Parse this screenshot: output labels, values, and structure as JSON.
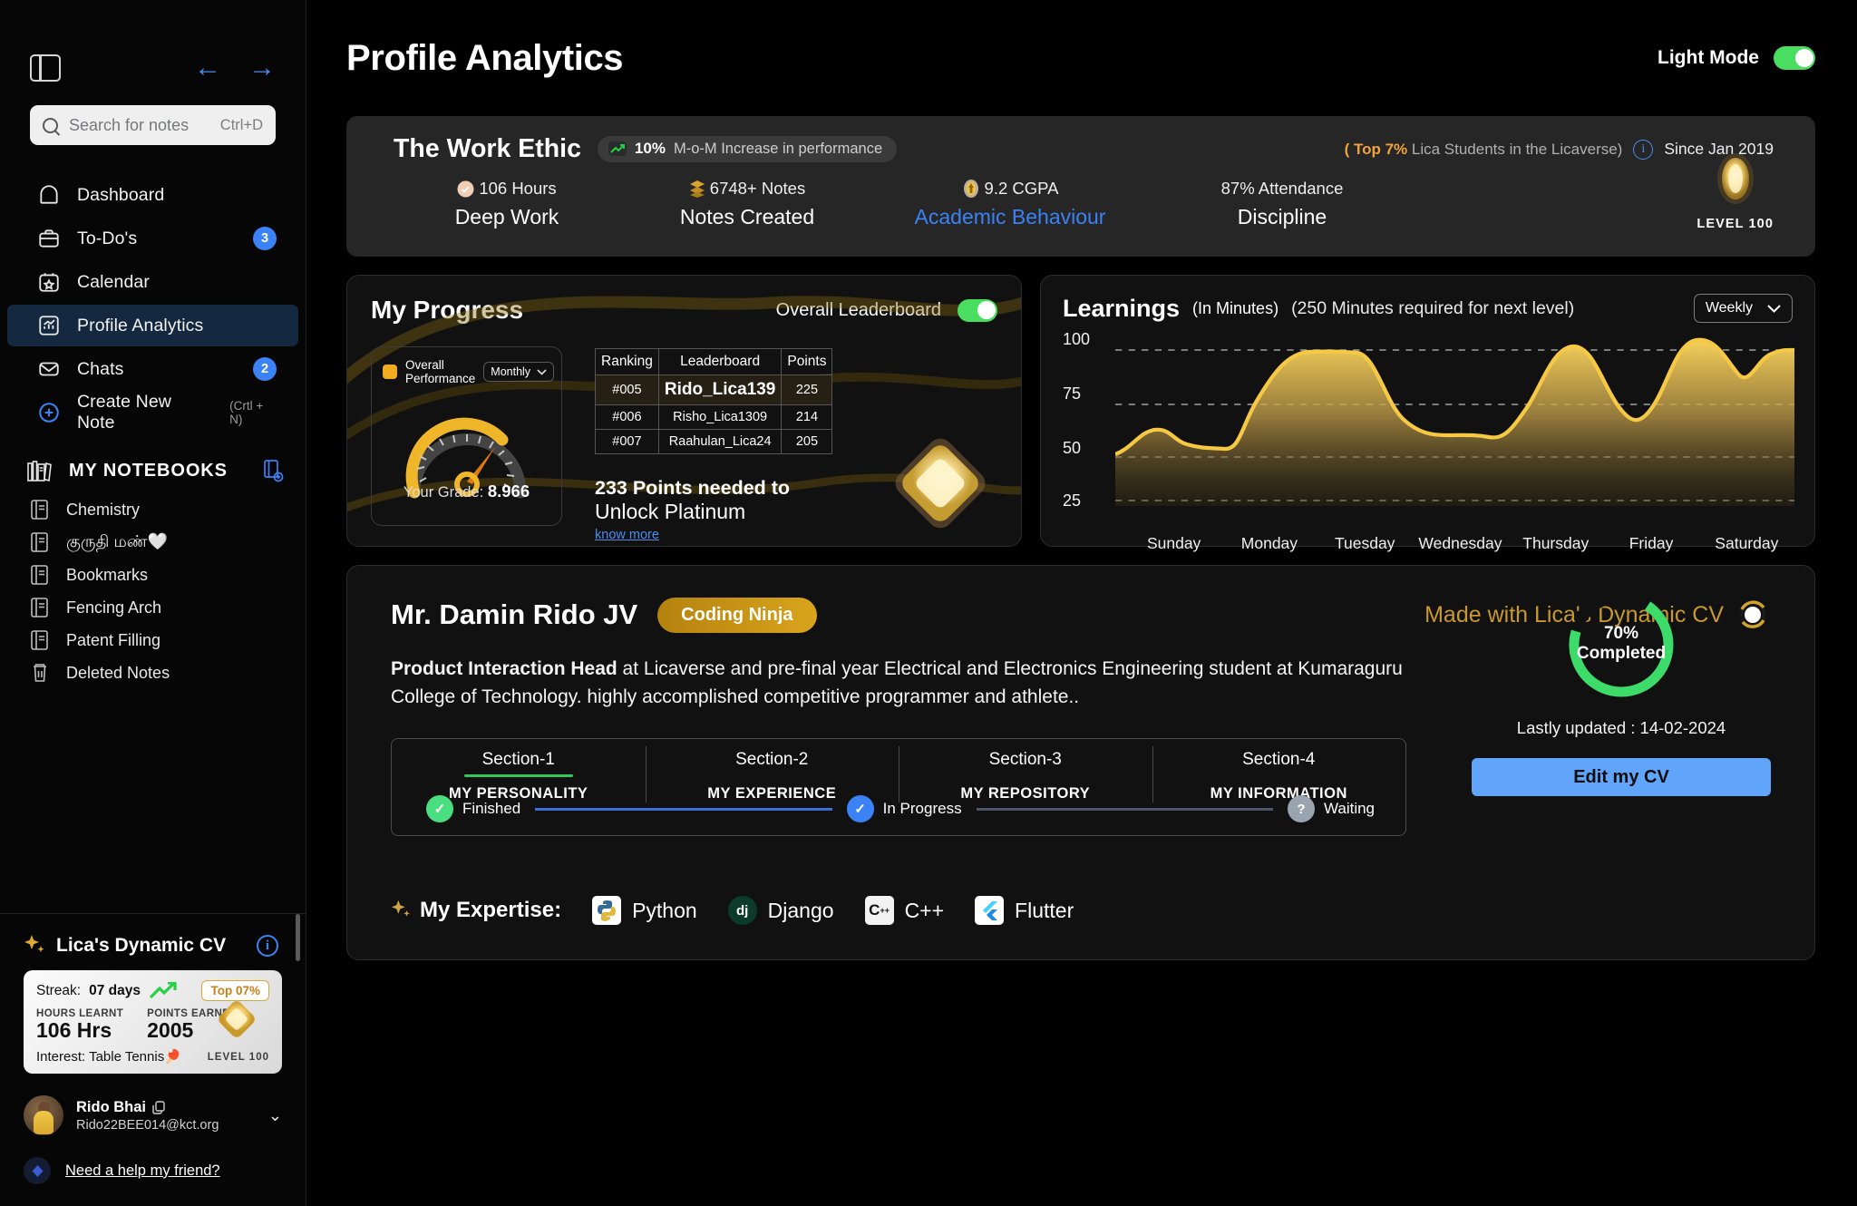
{
  "sidebar": {
    "panel_icon": "panel-toggle-icon",
    "back_arrow": "←",
    "forward_arrow": "→",
    "search": {
      "placeholder": "Search for notes",
      "shortcut": "Ctrl+D"
    },
    "nav": [
      {
        "label": "Dashboard",
        "icon": "home-icon",
        "badge": ""
      },
      {
        "label": "To-Do's",
        "icon": "briefcase-icon",
        "badge": "3"
      },
      {
        "label": "Calendar",
        "icon": "calendar-star-icon",
        "badge": ""
      },
      {
        "label": "Profile Analytics",
        "icon": "analytics-icon",
        "badge": "",
        "active": true
      },
      {
        "label": "Chats",
        "icon": "mail-icon",
        "badge": "2"
      },
      {
        "label": "Create New Note",
        "icon": "plus-circle-icon",
        "hint": "(Crtl + N)"
      }
    ],
    "notebooks_header": "MY NOTEBOOKS",
    "notebooks": [
      {
        "label": "Chemistry"
      },
      {
        "label": "குருதி மண்🤍"
      },
      {
        "label": "Bookmarks"
      },
      {
        "label": "Fencing Arch"
      },
      {
        "label": "Patent Filling"
      },
      {
        "label": "Deleted Notes",
        "icon": "trash-icon"
      }
    ],
    "cv": {
      "title": "Lica's Dynamic CV",
      "streak_label": "Streak:",
      "streak_value": "07 days",
      "top_pill": "Top 07%",
      "hours_key": "HOURS LEARNT",
      "hours_value": "106 Hrs",
      "points_key": "POINTS EARNED",
      "points_value": "2005",
      "interest": "Interest: Table Tennis🏓",
      "level": "LEVEL 100"
    },
    "user": {
      "name": "Rido Bhai",
      "email": "Rido22BEE014@kct.org"
    },
    "help": "Need a help my friend?"
  },
  "header": {
    "title": "Profile Analytics",
    "light_mode_label": "Light Mode",
    "light_mode_on": true
  },
  "work_ethic": {
    "title": "The Work Ethic",
    "pill_pct": "10%",
    "pill_text": "M-o-M  Increase in performance",
    "top_prefix": "( Top 7%",
    "top_suffix": " Lica Students in the Licaverse)",
    "since": "Since Jan 2019",
    "stats": [
      {
        "value": "106 Hours",
        "name": "Deep Work",
        "icon": "clock-icon"
      },
      {
        "value": "6748+ Notes",
        "name": "Notes Created",
        "icon": "layers-icon"
      },
      {
        "value": "9.2 CGPA",
        "name": "Academic Behaviour",
        "icon": "badge-icon",
        "accent": "#3b82f6"
      },
      {
        "value": "87% Attendance",
        "name": "Discipline",
        "icon": ""
      }
    ],
    "level_badge": "LEVEL 100"
  },
  "progress": {
    "title": "My Progress",
    "leaderboard_toggle_label": "Overall Leaderboard",
    "leaderboard_toggle_on": true,
    "gauge": {
      "legend": "Overall Performance",
      "period": "Monthly",
      "grade_label": "Your Grade:",
      "grade_value": "8.966"
    },
    "table": {
      "columns": [
        "Ranking",
        "Leaderboard",
        "Points"
      ],
      "rows": [
        {
          "rank": "#005",
          "name": "Rido_Lica139",
          "points": "225",
          "highlight": true
        },
        {
          "rank": "#006",
          "name": "Risho_Lica1309",
          "points": "214"
        },
        {
          "rank": "#007",
          "name": "Raahulan_Lica24",
          "points": "205"
        }
      ]
    },
    "unlock_line1": "233 Points needed to",
    "unlock_line2_a": "Unlock ",
    "unlock_line2_b": "Platinum",
    "know_more": "know more"
  },
  "chart_data": {
    "type": "area",
    "title": "Learnings",
    "subtitle": "(In Minutes)",
    "annotation": "(250 Minutes required for next level)",
    "period_selector": "Weekly",
    "categories": [
      "Sunday",
      "Monday",
      "Tuesday",
      "Wednesday",
      "Thursday",
      "Friday",
      "Saturday"
    ],
    "values": [
      51,
      58,
      96,
      65,
      102,
      75,
      99
    ],
    "detail_points": [
      51,
      66,
      59,
      57,
      96,
      96,
      66,
      65,
      64,
      102,
      75,
      108,
      94,
      99
    ],
    "ylabel": "",
    "xlabel": "",
    "yticks": [
      25,
      50,
      75,
      100
    ],
    "ylim": [
      25,
      110
    ],
    "grid": true,
    "legend": "none",
    "color": "#f5c344"
  },
  "cv_section": {
    "name": "Mr. Damin Rido JV",
    "tag": "Coding Ninja",
    "made_with": "Made with Lica's Dynamic CV",
    "desc_bold": "Product Interaction Head",
    "desc_rest": " at Licaverse and pre-final year Electrical and Electronics Engineering student at Kumaraguru College of Technology. highly accomplished competitive programmer and athlete..",
    "sections": [
      {
        "n": "Section-1",
        "sub": "MY PERSONALITY",
        "active": true
      },
      {
        "n": "Section-2",
        "sub": "MY EXPERIENCE",
        "active": false
      },
      {
        "n": "Section-3",
        "sub": "MY REPOSITORY",
        "active": false
      },
      {
        "n": "Section-4",
        "sub": "MY INFORMATION",
        "active": false
      }
    ],
    "steps": [
      {
        "label": "Finished",
        "mark": "✓",
        "color": "#4ade80"
      },
      {
        "label": "In Progress",
        "mark": "✓",
        "color": "#3b82f6"
      },
      {
        "label": "Waiting",
        "mark": "?",
        "color": "#9aa3b0"
      }
    ],
    "expertise_label": "My Expertise:",
    "expertise": [
      {
        "name": "Python",
        "icon": "python-logo"
      },
      {
        "name": "Django",
        "icon": "django-logo"
      },
      {
        "name": "C++",
        "icon": "cpp-logo"
      },
      {
        "name": "Flutter",
        "icon": "flutter-logo"
      }
    ],
    "completion_pct": "70%",
    "completion_label": "Completed",
    "last_updated": "Lastly updated : 14-02-2024",
    "edit_button": "Edit my CV"
  }
}
